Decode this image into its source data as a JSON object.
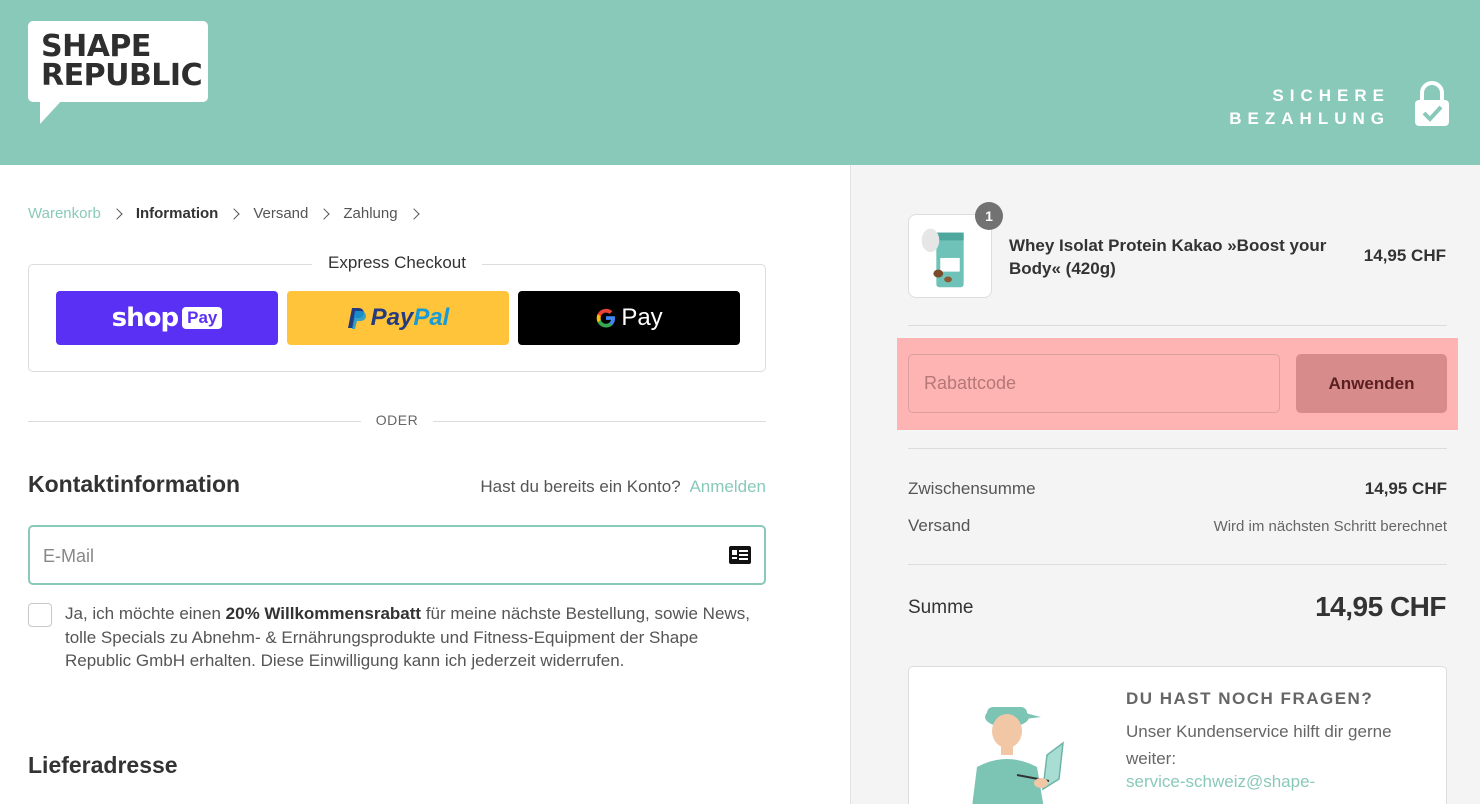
{
  "brand": {
    "logo_line1": "SHAPE",
    "logo_line2": "REPUBLIC",
    "secure_line1": "SICHERE",
    "secure_line2": "BEZAHLUNG",
    "accent_color": "#89c9b9"
  },
  "breadcrumb": {
    "items": [
      "Warenkorb",
      "Information",
      "Versand",
      "Zahlung"
    ],
    "active": "Information"
  },
  "express": {
    "title": "Express Checkout",
    "shop_pay": {
      "text": "shop",
      "badge": "Pay",
      "color": "#5a31f4"
    },
    "paypal": {
      "part1": "Pay",
      "part2": "Pal",
      "color": "#ffc439"
    },
    "gpay": {
      "text": "Pay",
      "color": "#000000"
    },
    "divider": "ODER"
  },
  "contact": {
    "title": "Kontaktinformation",
    "login_prompt": "Hast du bereits ein Konto?",
    "login_link": "Anmelden",
    "email_placeholder": "E-Mail",
    "email_icon": "contact-card-icon",
    "consent_part1": "Ja, ich möchte einen",
    "consent_bold": "20% Willkommensrabatt",
    "consent_part2": "für meine nächste Bestellung, sowie News, tolle Specials zu Abnehm- & Ernährungsprodukte und Fitness-Equipment der Shape Republic GmbH erhalten. Diese Einwilligung kann ich jederzeit widerrufen.",
    "consent_checked": false
  },
  "address": {
    "title": "Lieferadresse"
  },
  "cart": {
    "item": {
      "name": "Whey Isolat Protein Kakao »Boost your Body« (420g)",
      "quantity": "1",
      "price": "14,95 CHF"
    },
    "discount_placeholder": "Rabattcode",
    "apply_label": "Anwenden",
    "subtotal_label": "Zwischensumme",
    "subtotal_value": "14,95 CHF",
    "shipping_label": "Versand",
    "shipping_value": "Wird im nächsten Schritt berechnet",
    "total_label": "Summe",
    "total_value": "14,95 CHF"
  },
  "help": {
    "title": "DU HAST NOCH FRAGEN?",
    "text": "Unser Kundenservice hilft dir gerne weiter:",
    "email": "service-schweiz@shape-"
  }
}
